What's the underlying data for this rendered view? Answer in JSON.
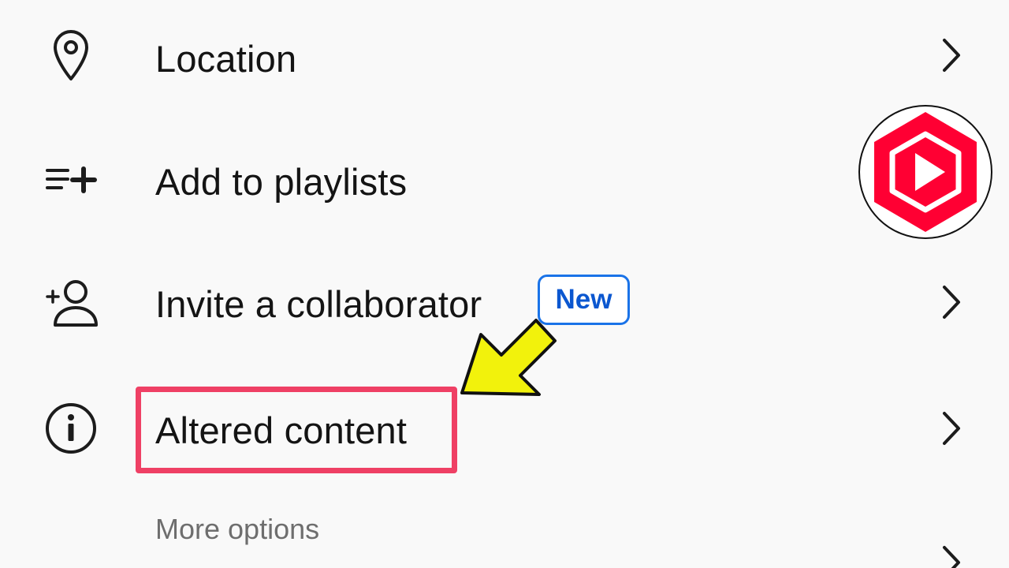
{
  "menu": {
    "items": [
      {
        "label": "Location",
        "icon": "location-pin-icon"
      },
      {
        "label": "Add to playlists",
        "icon": "playlist-add-icon"
      },
      {
        "label": "Invite a collaborator",
        "icon": "add-person-icon",
        "badge": "New"
      },
      {
        "label": "Altered content",
        "icon": "info-icon",
        "highlighted": true
      }
    ],
    "section_header": "More options"
  },
  "colors": {
    "highlight_border": "#ef4065",
    "badge_blue": "#1a73e8",
    "arrow_yellow": "#f2f20c",
    "logo_red": "#ff0033"
  },
  "overlay": {
    "logo": "youtube-studio-logo",
    "annotation": "yellow-pointer-arrow"
  }
}
